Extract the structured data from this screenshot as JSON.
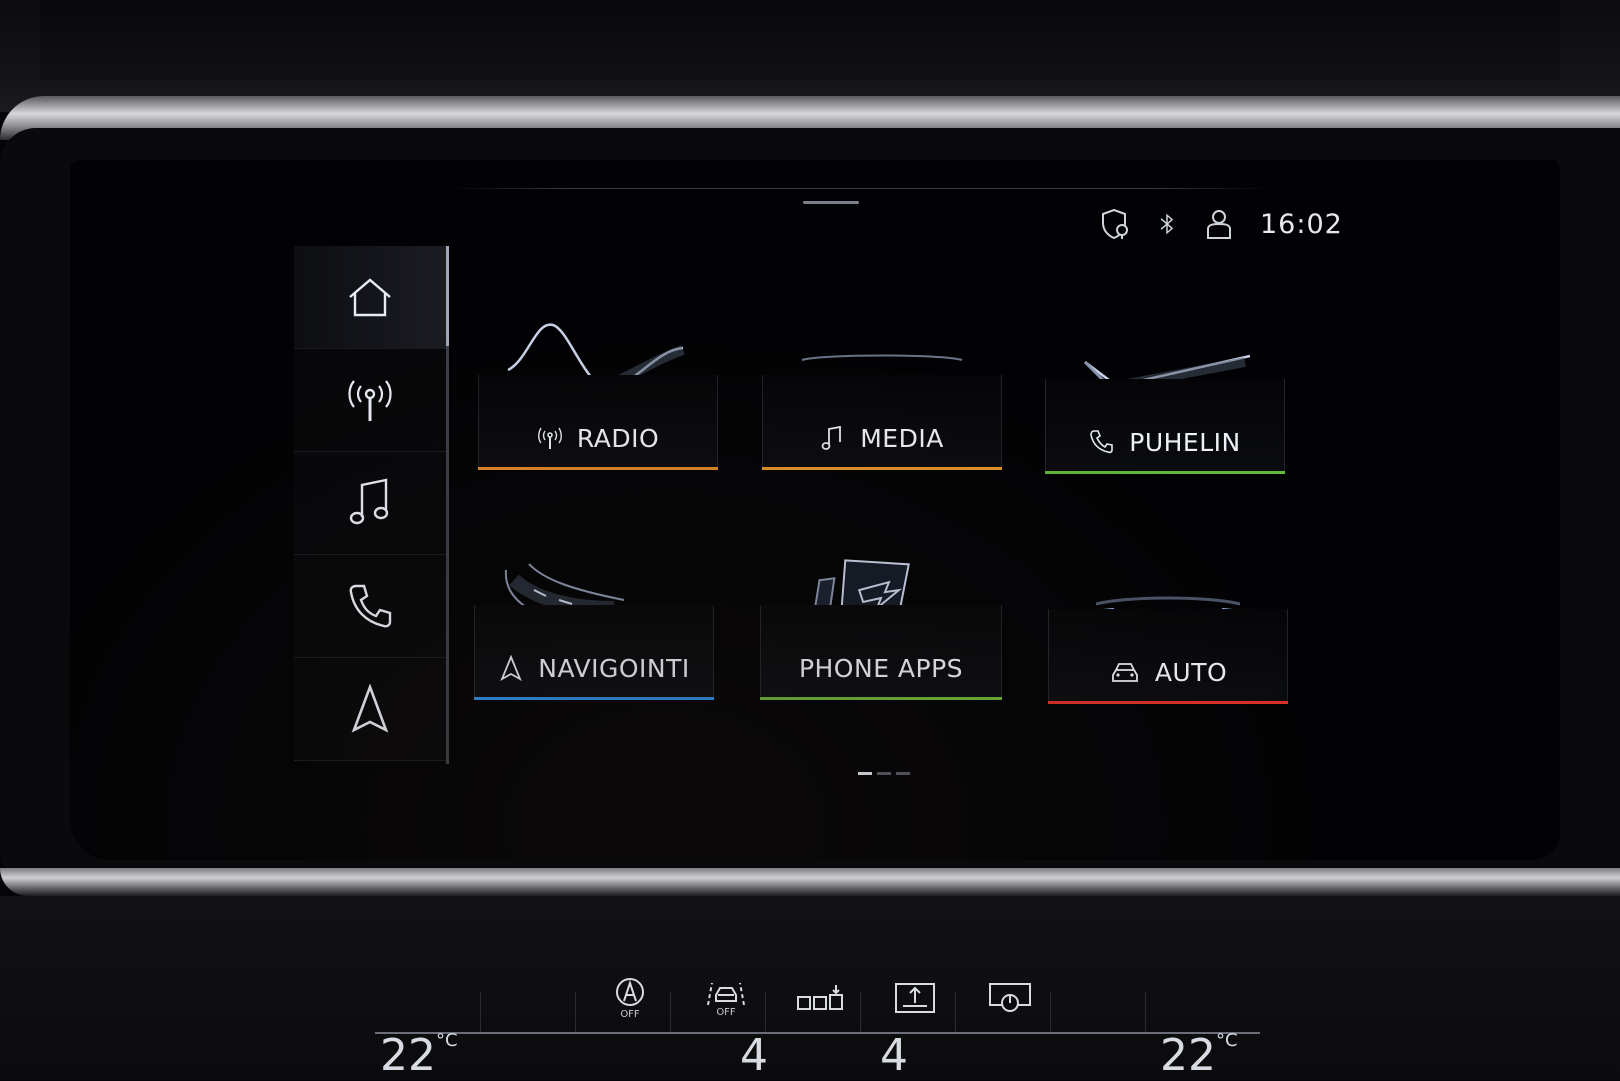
{
  "status_bar": {
    "time": "16:02",
    "icons": [
      "location-shield-icon",
      "bluetooth-icon",
      "user-profile-icon"
    ]
  },
  "sidebar": {
    "items": [
      {
        "icon": "home-icon",
        "active": true
      },
      {
        "icon": "radio-icon",
        "active": false
      },
      {
        "icon": "music-note-icon",
        "active": false
      },
      {
        "icon": "phone-icon",
        "active": false
      },
      {
        "icon": "navigation-arrow-icon",
        "active": false
      }
    ]
  },
  "tiles": [
    {
      "label": "RADIO",
      "icon": "radio-icon",
      "accent": "#e0892a"
    },
    {
      "label": "MEDIA",
      "icon": "music-note-icon",
      "accent": "#e2962c"
    },
    {
      "label": "PUHELIN",
      "icon": "phone-icon",
      "accent": "#5fb83a"
    },
    {
      "label": "NAVIGOINTI",
      "icon": "navigation-arrow-icon",
      "accent": "#2f8fe0"
    },
    {
      "label": "PHONE APPS",
      "icon": "",
      "accent": "#6cb83c"
    },
    {
      "label": "AUTO",
      "icon": "car-icon",
      "accent": "#e0302a"
    }
  ],
  "pager": {
    "pages": 3,
    "current": 1
  },
  "climate": {
    "left_temp": "22",
    "right_temp": "22",
    "unit": "°C",
    "left_fan": "4",
    "right_fan": "4",
    "buttons": [
      {
        "icon": "auto-start-stop-icon",
        "text": "OFF"
      },
      {
        "icon": "traction-off-icon",
        "text": "OFF"
      },
      {
        "icon": "seat-heating-icon",
        "text": ""
      },
      {
        "icon": "screen-adjust-icon",
        "text": ""
      },
      {
        "icon": "display-power-icon",
        "text": ""
      }
    ]
  }
}
